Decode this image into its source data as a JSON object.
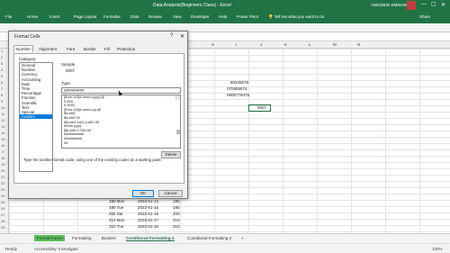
{
  "window": {
    "title": "Data Analysis(Beginners Class) - Excel",
    "user": "AWODIDE EMMANUEL",
    "minimize": "—",
    "maximize": "☐",
    "close": "✕"
  },
  "ribbon": {
    "tabs": [
      "File",
      "Home",
      "Insert",
      "Page Layout",
      "Formulas",
      "Data",
      "Review",
      "View",
      "Developer",
      "Help",
      "Power Pivot",
      "💡 Tell me what you want to do"
    ],
    "share": "Share"
  },
  "columns": [
    "H",
    "I",
    "J",
    "K",
    "L",
    "M",
    "N"
  ],
  "rows": [
    "1",
    "2",
    "3",
    "4",
    "5",
    "6",
    "7",
    "8",
    "9",
    "10",
    "11",
    "12",
    "13",
    "14",
    "15",
    "16",
    "17",
    "18",
    "19",
    "20",
    "21",
    "22",
    "23",
    "24",
    "25",
    "26",
    "27",
    "28",
    "29"
  ],
  "cells": {
    "h6": "80345678",
    "h7": "070685674",
    "h8": "0905778476",
    "j9": "0007",
    "bottom": [
      {
        "a": "190 Mon",
        "b": "2022-01-14",
        "c": "190"
      },
      {
        "a": "190 Tue",
        "b": "2022-01-15",
        "c": "190"
      },
      {
        "a": "200 Sat",
        "b": "2022-01-16",
        "c": "200"
      },
      {
        "a": "210 Mon",
        "b": "2022-01-17",
        "c": "210"
      },
      {
        "a": "210 Tue",
        "b": "2022-01-18",
        "c": "210"
      }
    ]
  },
  "sheets": {
    "items": [
      "Format Panes",
      "Formatting",
      "Borders",
      "Conditional Formatting-1",
      "Conditional Formatting-2"
    ],
    "active": "Conditional Formatting-1",
    "add": "+"
  },
  "status": {
    "ready": "Ready",
    "accessibility": "Accessibility: Investigate",
    "zoom": "100%"
  },
  "dialog": {
    "title": "Format Cells",
    "help": "?",
    "close": "✕",
    "tabs": [
      "Number",
      "Alignment",
      "Font",
      "Border",
      "Fill",
      "Protection"
    ],
    "category_label": "Category:",
    "categories": [
      "General",
      "Number",
      "Currency",
      "Accounting",
      "Date",
      "Time",
      "Percentage",
      "Fraction",
      "Scientific",
      "Text",
      "Special",
      "Custom"
    ],
    "selected_category": "Custom",
    "sample_label": "Sample",
    "sample_value": "0007",
    "type_label": "Type:",
    "type_value": "0########",
    "types": [
      "[$-en-US]d-mmm-yyyy;@",
      "0.000",
      "0.0000",
      "[$-en-US]d-mmm-yy;@",
      "$#,##0;",
      "$#,##0.00",
      "[$#,##0-162] #,##0.00",
      "mmm-yyyy",
      "[$#,##0-170]0.00",
      "##########",
      "0########",
      "0#"
    ],
    "delete": "Delete",
    "hint": "Type the number format code, using one of the existing codes as a starting point.",
    "ok": "OK",
    "cancel": "Cancel"
  }
}
